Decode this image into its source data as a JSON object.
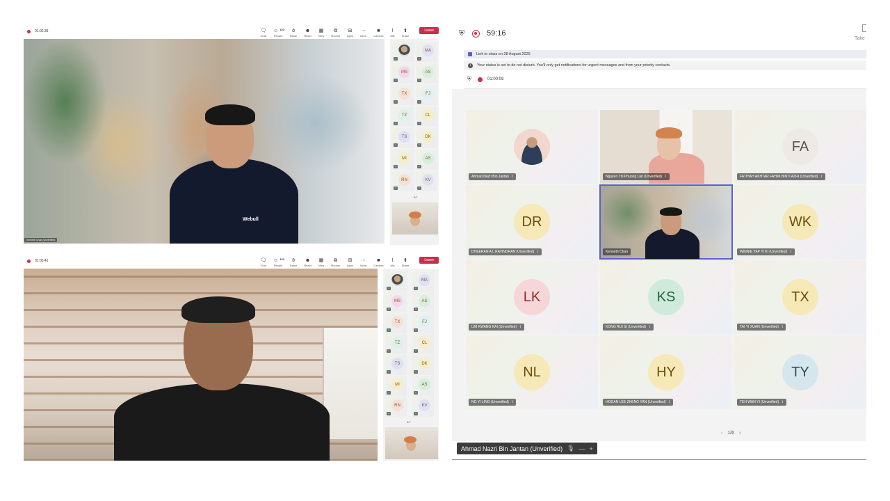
{
  "colors": {
    "leave": "#c4314b",
    "accent": "#5b5fc7",
    "record": "#c4314b"
  },
  "meeting_top": {
    "timer": "01:02:39",
    "toolbar": [
      {
        "icon": "chat-icon",
        "label": "Chat"
      },
      {
        "icon": "people-icon",
        "label": "People",
        "badge": "102"
      },
      {
        "icon": "raise-hand-icon",
        "label": "Raise"
      },
      {
        "icon": "react-icon",
        "label": "React"
      },
      {
        "icon": "view-icon",
        "label": "View"
      },
      {
        "icon": "rooms-icon",
        "label": "Rooms"
      },
      {
        "icon": "apps-icon",
        "label": "Apps"
      },
      {
        "icon": "more-icon",
        "label": "More"
      },
      {
        "icon": "camera-icon",
        "label": "Camera"
      },
      {
        "icon": "mic-icon",
        "label": "Mic"
      },
      {
        "icon": "share-icon",
        "label": "Share"
      }
    ],
    "leave_label": "Leave",
    "speaker_name": "Kenneth Chan (Unverified)",
    "shirt_logo": "Webull",
    "pager": "3/7"
  },
  "meeting_bottom": {
    "timer": "01:03:41",
    "toolbar": [
      {
        "icon": "chat-icon",
        "label": "Chat"
      },
      {
        "icon": "people-icon",
        "label": "People",
        "badge": "102"
      },
      {
        "icon": "raise-hand-icon",
        "label": "Raise"
      },
      {
        "icon": "react-icon",
        "label": "React"
      },
      {
        "icon": "view-icon",
        "label": "View"
      },
      {
        "icon": "rooms-icon",
        "label": "Rooms"
      },
      {
        "icon": "apps-icon",
        "label": "Apps"
      },
      {
        "icon": "more-icon",
        "label": "More"
      },
      {
        "icon": "camera-icon",
        "label": "Camera"
      },
      {
        "icon": "mic-icon",
        "label": "Mic"
      },
      {
        "icon": "share-icon",
        "label": "Share"
      }
    ],
    "leave_label": "Leave",
    "pager": "3/7"
  },
  "side_participants": [
    [
      "",
      "MA"
    ],
    [
      "MS",
      "AS"
    ],
    [
      "TX",
      "FJ"
    ],
    [
      "TZ",
      "CL"
    ],
    [
      "TS",
      "DK"
    ],
    [
      "MI",
      "AS"
    ],
    [
      "RN",
      "KV"
    ]
  ],
  "main": {
    "timer": "59:16",
    "take_label": "Take",
    "link_banner": "Link to class on 28 August 2025",
    "status_banner": "Your status is set to do not disturb. You'll only get notifications for urgent messages and from your priority contacts.",
    "inner_timer": "01:00:09",
    "tiles": [
      {
        "initials": "",
        "name": "Ahmad Nazri Bin Jantan",
        "type": "photo",
        "bg": "#ffffff",
        "fg": "#333333"
      },
      {
        "initials": "",
        "name": "Nguyen Thi Phuong Lan (Unverified)",
        "type": "video-woman",
        "bg": "#ffffff",
        "fg": "#333333"
      },
      {
        "initials": "FA",
        "name": "FATIHAH AKHTAR FAHMI BINTI AZRI (Unverified)",
        "type": "avatar",
        "bg": "#efe9e5",
        "fg": "#555555"
      },
      {
        "initials": "DR",
        "name": "DHEERAN A L RAVINDRAN (Unverified)",
        "type": "avatar",
        "bg": "#f7e8b8",
        "fg": "#6b4d0e"
      },
      {
        "initials": "",
        "name": "Kenneth Chan",
        "type": "video-man",
        "bg": "#ffffff",
        "fg": "#333333"
      },
      {
        "initials": "WK",
        "name": "WINNIE YAP YI KI (Unverified)",
        "type": "avatar",
        "bg": "#f7e8b8",
        "fg": "#6b4d0e"
      },
      {
        "initials": "LK",
        "name": "LIM KWANG KAI (Unverified)",
        "type": "avatar",
        "bg": "#f6d6d6",
        "fg": "#8a2f2f"
      },
      {
        "initials": "KS",
        "name": "KONG RUI SI (Unverified)",
        "type": "avatar",
        "bg": "#cfeadb",
        "fg": "#1f6640"
      },
      {
        "initials": "TX",
        "name": "TAI YI XUAN (Unverified)",
        "type": "avatar",
        "bg": "#f7e8b8",
        "fg": "#6b4d0e"
      },
      {
        "initials": "NL",
        "name": "NG YI LING (Unverified)",
        "type": "avatar",
        "bg": "#f7e8b8",
        "fg": "#6b4d0e"
      },
      {
        "initials": "HY",
        "name": "HOGAN LEE ZHENG YAN (Unverified)",
        "type": "avatar",
        "bg": "#f7e8b8",
        "fg": "#6b4d0e"
      },
      {
        "initials": "TY",
        "name": "TEH WAN YI (Unverified)",
        "type": "avatar",
        "bg": "#d5e6ec",
        "fg": "#2c4f5c"
      }
    ],
    "pager": "1/6",
    "bottom_name": "Ahmad Nazri Bin Jantan (Unverified)"
  }
}
